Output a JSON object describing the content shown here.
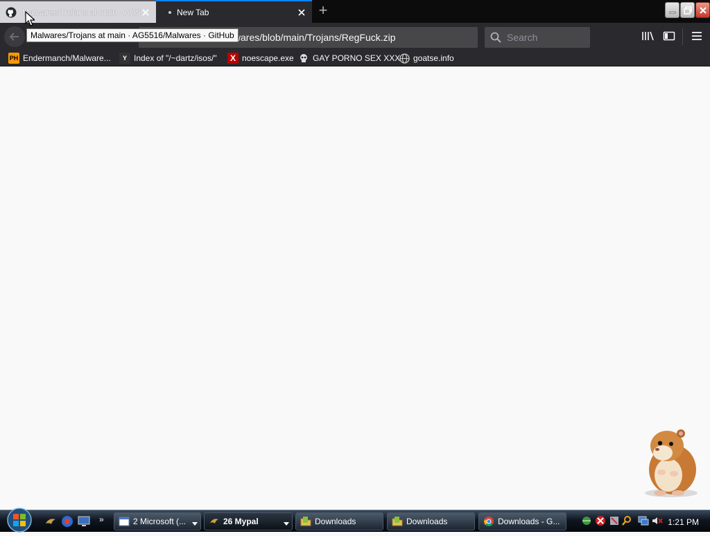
{
  "browser": {
    "tabs": [
      {
        "title": "Malwares/Trojans at main · AG5516/Malwares · GitHub",
        "icon": "github-icon",
        "active": false
      },
      {
        "title": "New Tab",
        "active": true
      }
    ],
    "tooltip": "Malwares/Trojans at main · AG5516/Malwares · GitHub",
    "url": "alwares/blob/main/Trojans/RegFuck.zip",
    "search_placeholder": "Search",
    "bookmarks": [
      {
        "label": "Endermanch/Malware...",
        "icon": "ph-icon",
        "icon_text": "PH"
      },
      {
        "label": "Index of \"/~dartz/isos/\"",
        "icon": "yc-icon",
        "icon_text": "Y"
      },
      {
        "label": "noescape.exe",
        "icon": "x-icon",
        "icon_text": "X"
      },
      {
        "label": "GAY PORNO SEX XXX",
        "icon": "skull-icon"
      },
      {
        "label": "goatse.info",
        "icon": "globe-icon"
      }
    ]
  },
  "taskbar": {
    "buttons": [
      {
        "label": "2 Microsoft (...",
        "icon": "window-icon"
      },
      {
        "label": "26 Mypal",
        "icon": "mypal-icon"
      },
      {
        "label": "Downloads",
        "icon": "folder-icon"
      },
      {
        "label": "Downloads",
        "icon": "folder-icon"
      },
      {
        "label": "Downloads - G...",
        "icon": "chrome-icon"
      }
    ],
    "clock": "1:21 PM"
  },
  "colors": {
    "accent": "#0a84ff",
    "toolbar": "#2a2a2e",
    "page": "#f9f9fa"
  }
}
